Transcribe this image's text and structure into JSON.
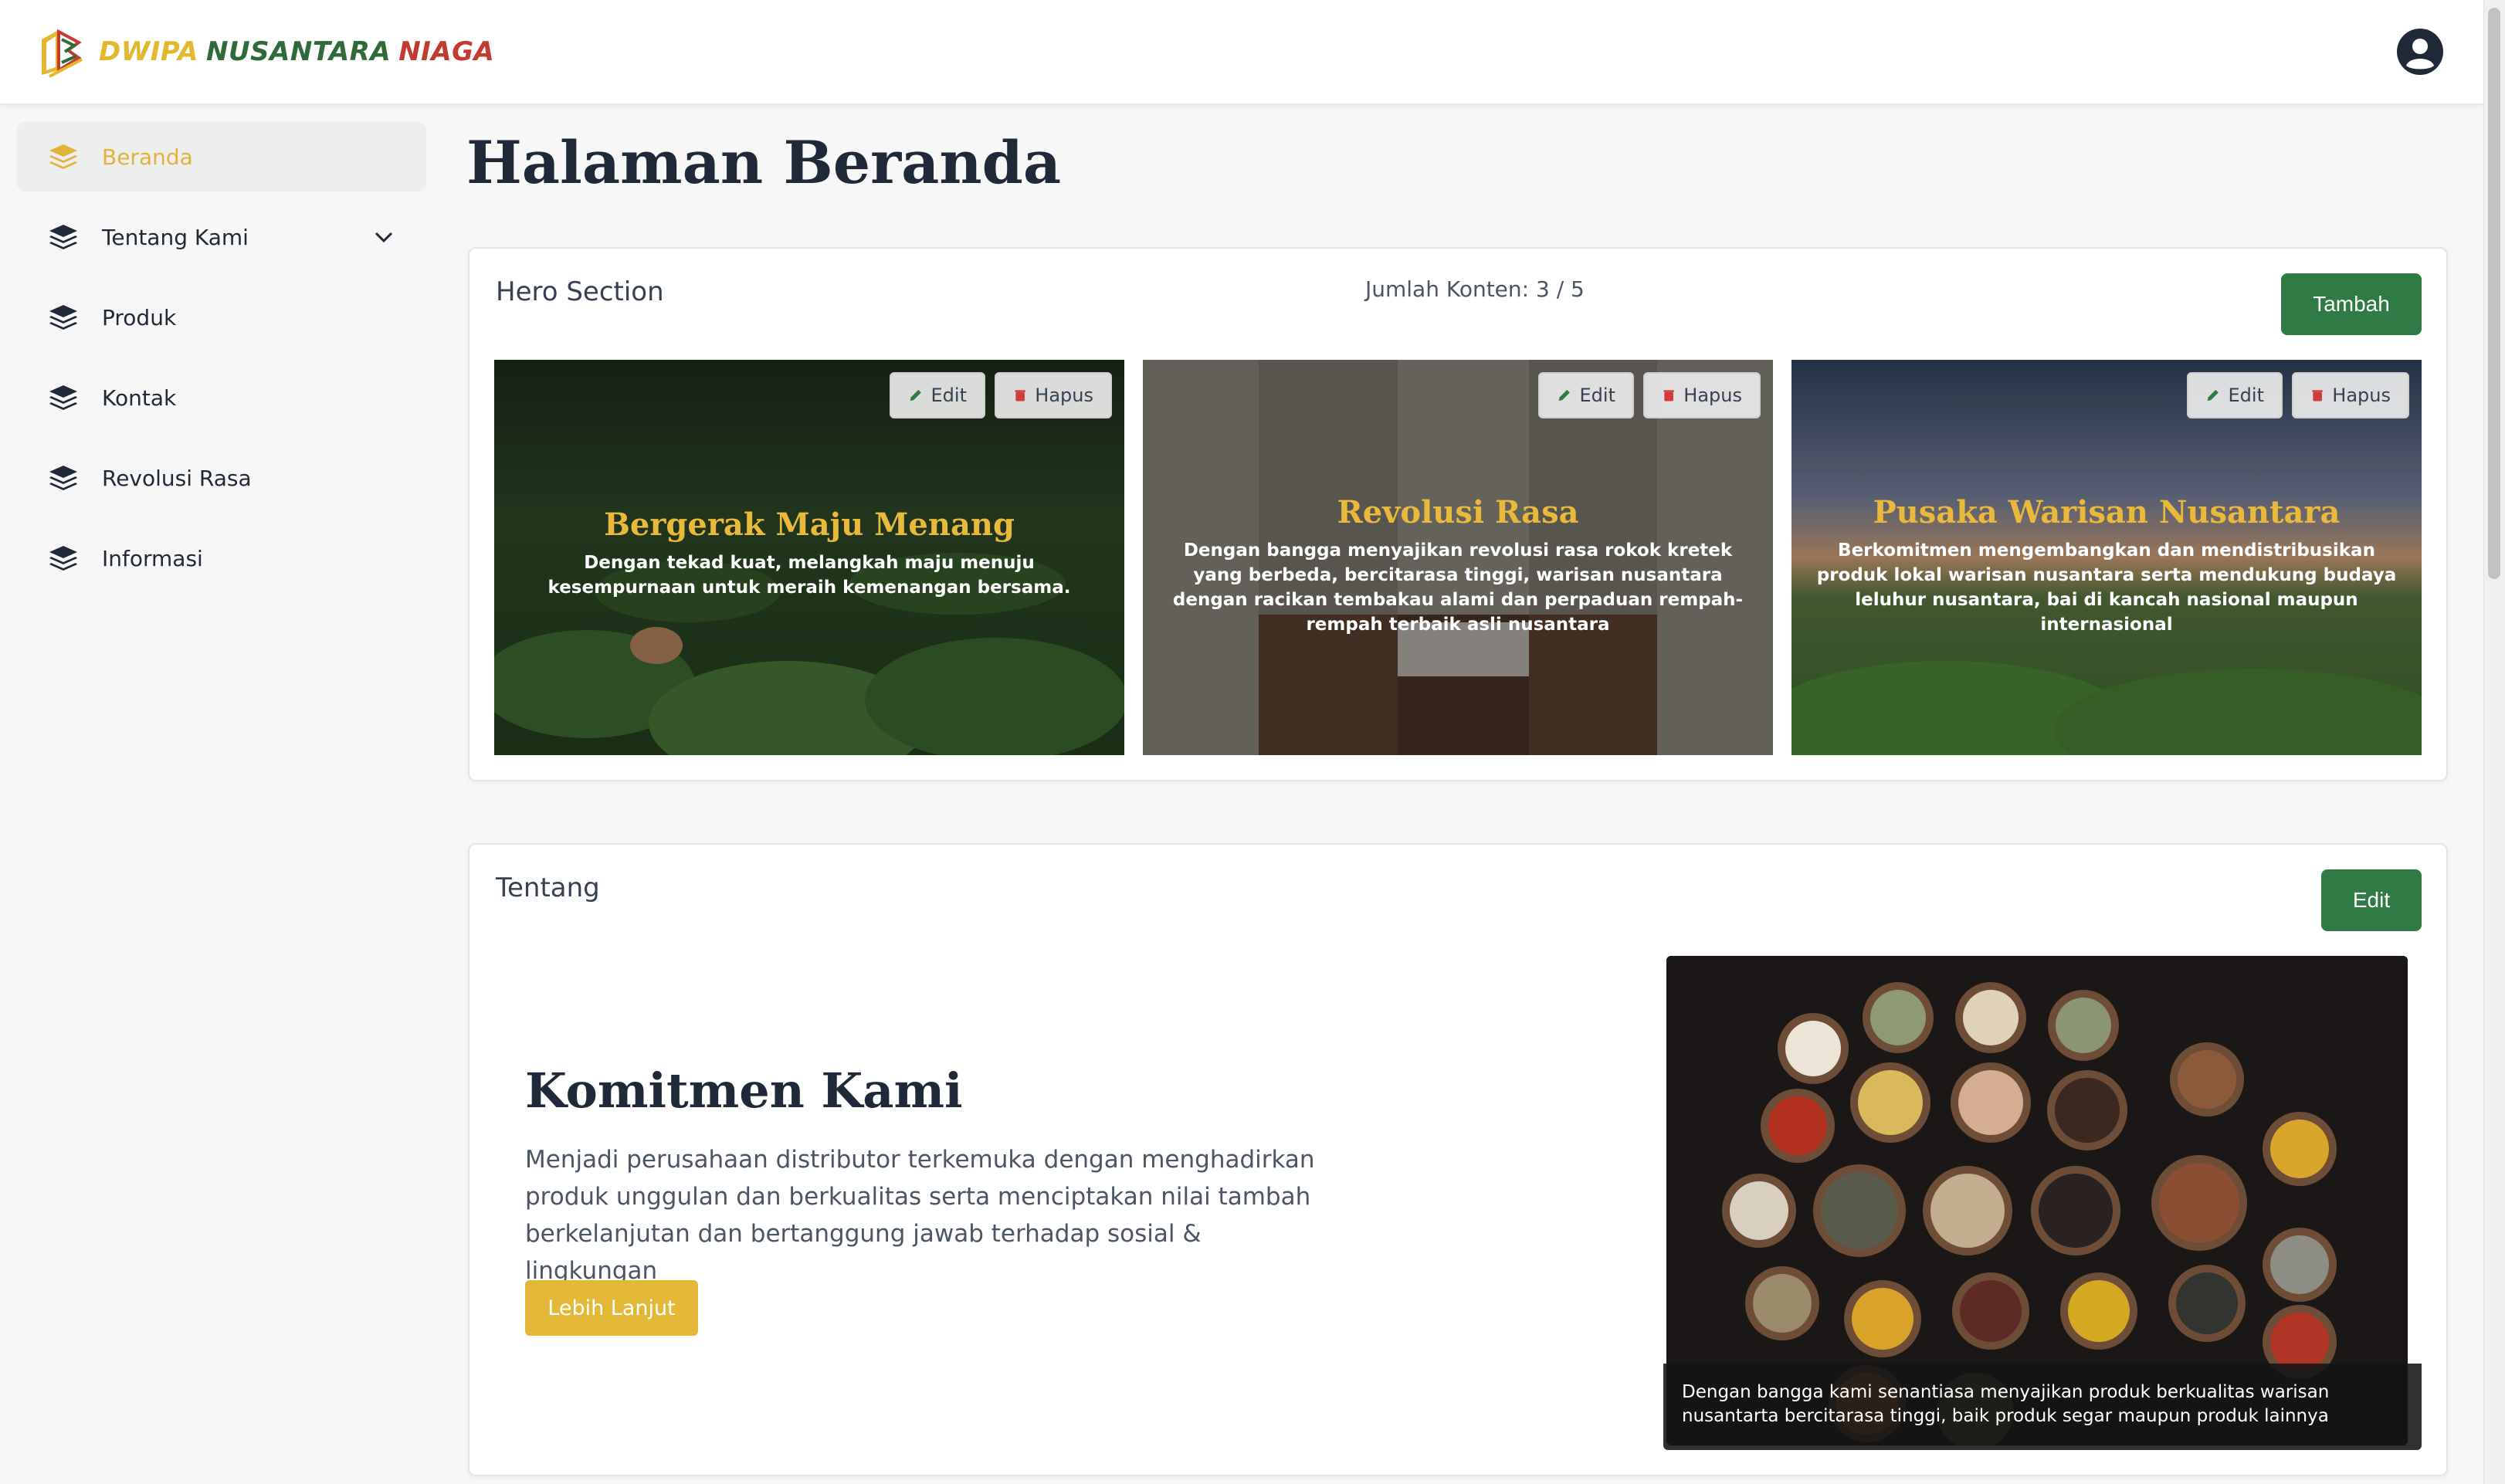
{
  "brand": {
    "word1": "DWIPA",
    "word2": "NUSANTARA",
    "word3": "NIAGA"
  },
  "sidebar": {
    "items": [
      {
        "label": "Beranda"
      },
      {
        "label": "Tentang Kami"
      },
      {
        "label": "Produk"
      },
      {
        "label": "Kontak"
      },
      {
        "label": "Revolusi Rasa"
      },
      {
        "label": "Informasi"
      }
    ]
  },
  "page": {
    "title": "Halaman Beranda"
  },
  "hero": {
    "title": "Hero Section",
    "count_text": "Jumlah Konten: 3 / 5",
    "add_label": "Tambah",
    "edit_label": "Edit",
    "delete_label": "Hapus",
    "slides": [
      {
        "title": "Bergerak Maju Menang",
        "desc": "Dengan tekad kuat, melangkah maju menuju kesempurnaan untuk meraih kemenangan bersama."
      },
      {
        "title": "Revolusi Rasa",
        "desc": "Dengan bangga menyajikan revolusi rasa rokok kretek yang berbeda, bercitarasa tinggi, warisan nusantara dengan racikan tembakau alami dan perpaduan rempah-rempah terbaik asli nusantara"
      },
      {
        "title": "Pusaka Warisan Nusantara",
        "desc": "Berkomitmen mengembangkan dan mendistribusikan produk lokal warisan nusantara serta mendukung budaya leluhur nusantara, bai di kancah nasional maupun internasional"
      }
    ]
  },
  "about": {
    "title": "Tentang",
    "edit_label": "Edit",
    "heading": "Komitmen Kami",
    "text": "Menjadi perusahaan distributor terkemuka dengan menghadirkan produk unggulan dan berkualitas serta menciptakan nilai tambah berkelanjutan dan bertanggung jawab terhadap sosial & lingkungan",
    "more_label": "Lebih Lanjut",
    "caption": "Dengan bangga kami senantiasa menyajikan produk berkualitas warisan nusantarta bercitarasa tinggi, baik produk segar maupun produk lainnya"
  },
  "colors": {
    "accent_gold": "#e3b836",
    "brand_green": "#2f7a45",
    "brand_red": "#c33a2f"
  }
}
